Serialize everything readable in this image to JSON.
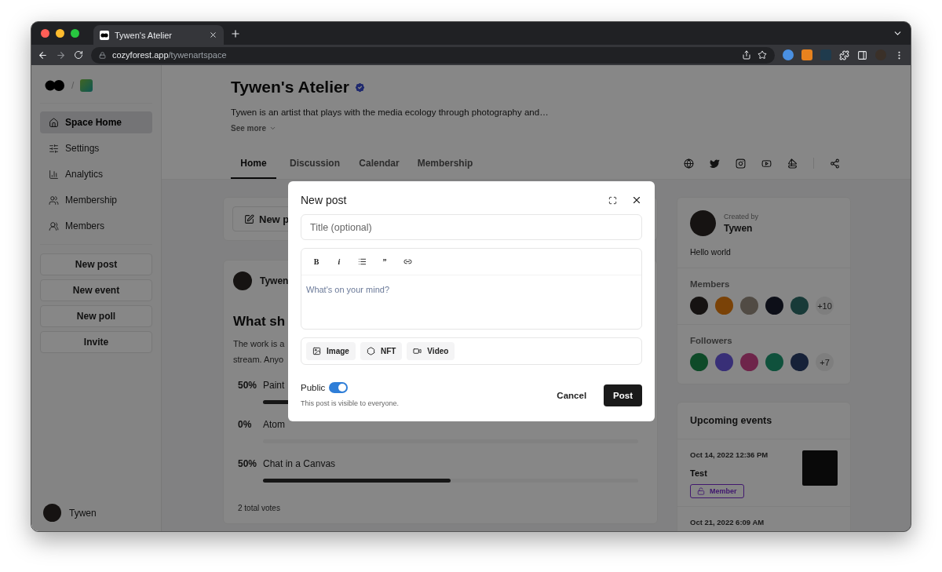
{
  "browser": {
    "tab": {
      "title": "Tywen's Atelier",
      "selected": true
    },
    "url": {
      "domain": "cozyforest.app",
      "path": "/tywenartspace"
    }
  },
  "sidebar": {
    "breadcrumb_separator": "/",
    "items": [
      {
        "label": "Space Home",
        "selected": true
      },
      {
        "label": "Settings",
        "selected": false
      },
      {
        "label": "Analytics",
        "selected": false
      },
      {
        "label": "Membership",
        "selected": false
      },
      {
        "label": "Members",
        "selected": false
      }
    ],
    "actions": [
      "New post",
      "New event",
      "New poll",
      "Invite"
    ],
    "user": "Tywen"
  },
  "space": {
    "title": "Tywen's Atelier",
    "verified": true,
    "description": "Tywen is an artist that plays with the media ecology through photography and…",
    "see_more": "See more",
    "tabs": [
      {
        "label": "Home",
        "selected": true
      },
      {
        "label": "Discussion",
        "selected": false
      },
      {
        "label": "Calendar",
        "selected": false
      },
      {
        "label": "Membership",
        "selected": false
      }
    ]
  },
  "feed": {
    "new_post_button": "New p",
    "poll": {
      "author": "Tywen",
      "title": "What sh",
      "text": [
        "The work is a",
        "stream. Anyo"
      ],
      "options": [
        {
          "percent": "50%",
          "label": "Paint",
          "level": 0.5
        },
        {
          "percent": "0%",
          "label": "Atom",
          "level": 0
        },
        {
          "percent": "50%",
          "label": "Chat in a Canvas",
          "level": 0.5
        }
      ],
      "total": "2 total votes"
    }
  },
  "about": {
    "created_by_label": "Created by",
    "creator": "Tywen",
    "bio": "Hello world",
    "members": {
      "title": "Members",
      "more": "+10"
    },
    "followers": {
      "title": "Followers",
      "more": "+7"
    }
  },
  "events": {
    "title": "Upcoming events",
    "items": [
      {
        "date": "Oct 14, 2022 12:36 PM",
        "name": "Test",
        "badge": "Member"
      },
      {
        "date": "Oct 21, 2022 6:09 AM"
      }
    ]
  },
  "dialog": {
    "title": "New post",
    "title_placeholder": "Title (optional)",
    "body_placeholder": "What's on your mind?",
    "format_tools": [
      {
        "kind": "bold",
        "label": "B"
      },
      {
        "kind": "italic",
        "label": "i"
      },
      {
        "kind": "list"
      },
      {
        "kind": "quote",
        "label": "”"
      },
      {
        "kind": "link"
      }
    ],
    "attachments": [
      {
        "kind": "image",
        "label": "Image"
      },
      {
        "kind": "nft",
        "label": "NFT"
      },
      {
        "kind": "video",
        "label": "Video"
      }
    ],
    "public": {
      "label": "Public",
      "on": true
    },
    "visibility_note": "This post is visible to everyone.",
    "cancel": "Cancel",
    "submit": "Post"
  }
}
